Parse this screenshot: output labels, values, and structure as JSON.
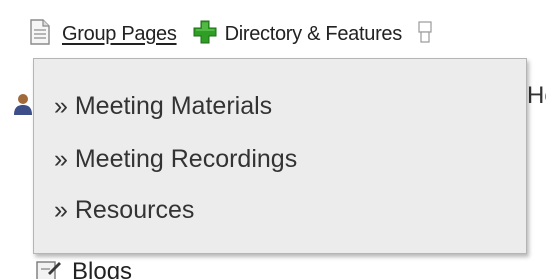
{
  "nav": {
    "items": [
      {
        "label": "Group Pages",
        "icon": "document-icon"
      },
      {
        "label": "Directory & Features",
        "icon": "plus-icon"
      },
      {
        "icon": "partial-icon"
      }
    ]
  },
  "dropdown": {
    "items": [
      {
        "label": "» Meeting Materials"
      },
      {
        "label": "» Meeting Recordings"
      },
      {
        "label": "» Resources"
      }
    ]
  },
  "background": {
    "right_fragment": "Ho",
    "blogs_label": "Blogs"
  },
  "colors": {
    "plus_green": "#2f9e24",
    "dropdown_bg": "#ececec",
    "text": "#333333"
  }
}
